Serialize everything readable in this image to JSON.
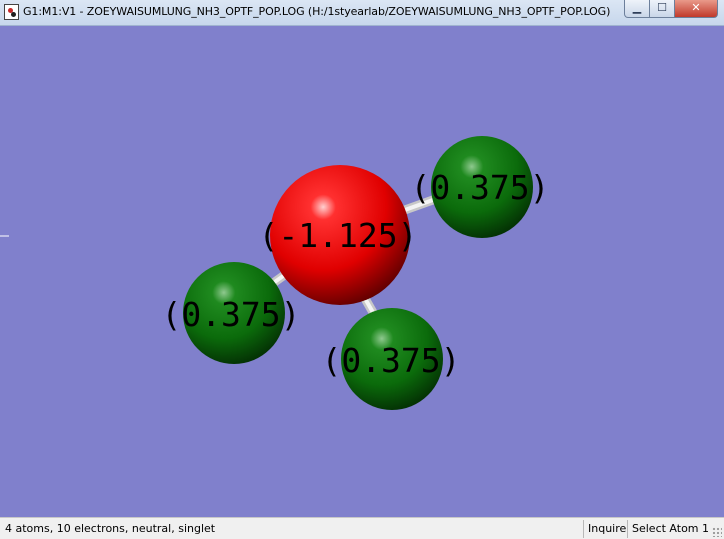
{
  "window": {
    "title": "G1:M1:V1 - ZOEYWAISUMLUNG_NH3_OPTF_POP.LOG (H:/1styearlab/ZOEYWAISUMLUNG_NH3_OPTF_POP.LOG)",
    "minimize_glyph": "▁",
    "maximize_glyph": "☐",
    "close_glyph": "✕"
  },
  "molecule": {
    "background_color": "#8080cc",
    "atoms": [
      {
        "element": "N",
        "charge_label": "(-1.125)",
        "color": "#e00000"
      },
      {
        "element": "H",
        "charge_label": "(0.375)",
        "color": "#0b6b0b"
      },
      {
        "element": "H",
        "charge_label": "(0.375)",
        "color": "#0b6b0b"
      },
      {
        "element": "H",
        "charge_label": "(0.375)",
        "color": "#0b6b0b"
      }
    ],
    "bond_color": "#e8e8e8"
  },
  "statusbar": {
    "summary": "4 atoms, 10 electrons, neutral, singlet",
    "mode": "Inquire",
    "action": "Select Atom 1"
  }
}
